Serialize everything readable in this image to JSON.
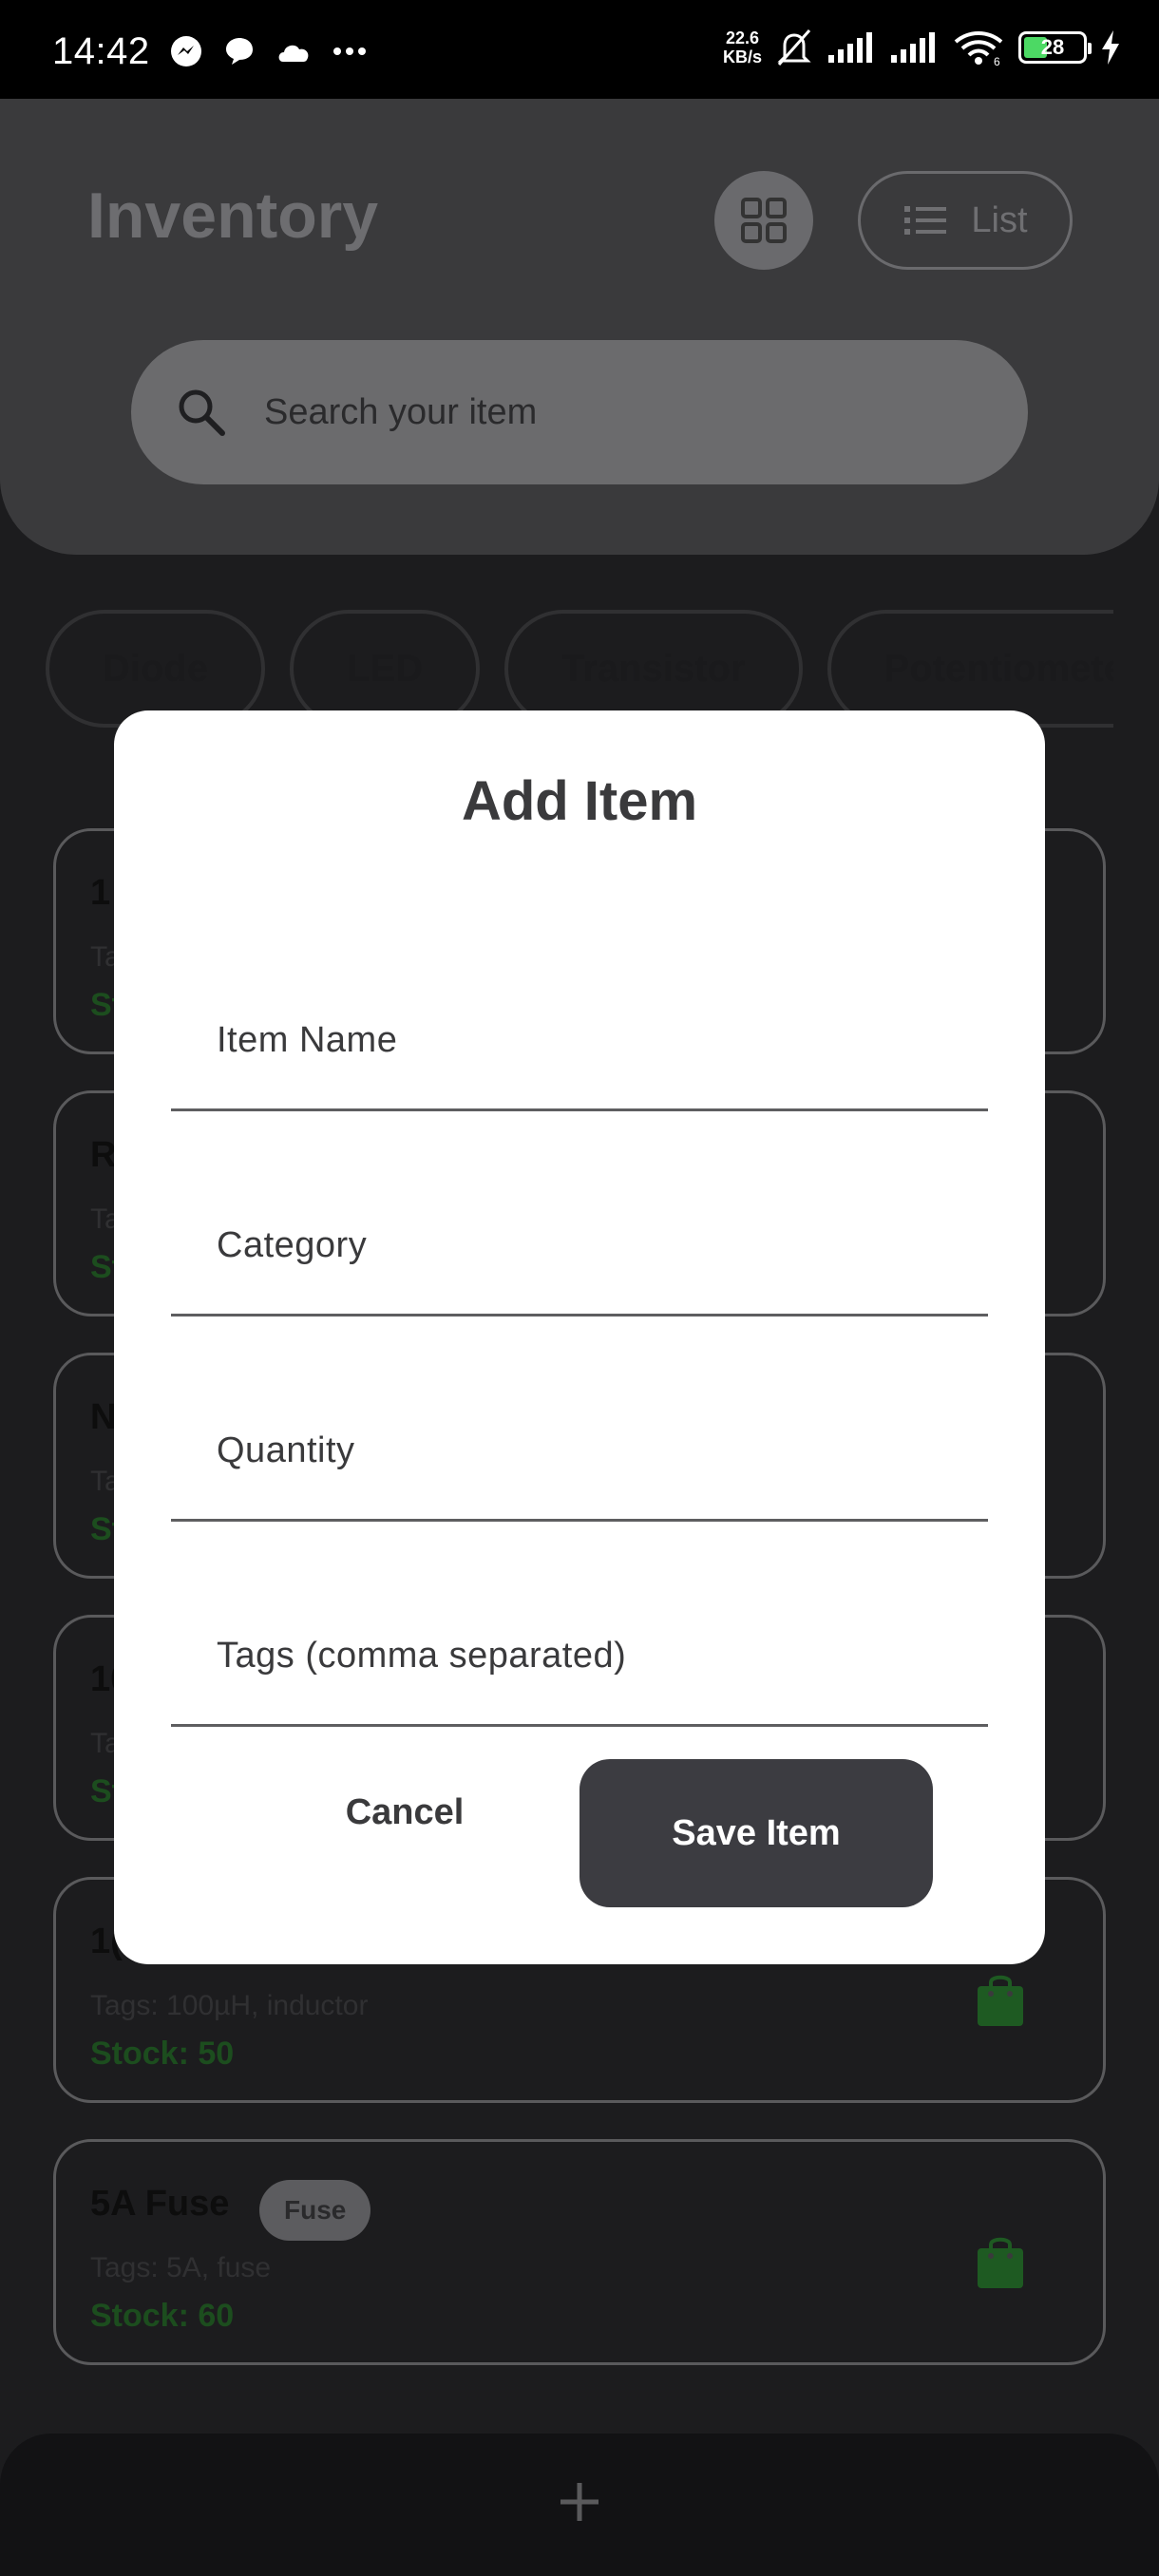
{
  "status_bar": {
    "time": "14:42",
    "net_speed_value": "22.6",
    "net_speed_unit": "KB/s",
    "wifi_badge": "6",
    "battery": "28"
  },
  "header": {
    "title": "Inventory",
    "list_label": "List",
    "search_placeholder": "Search your item"
  },
  "chips": [
    "Diode",
    "LED",
    "Transistor",
    "Potentiometer"
  ],
  "items": [
    {
      "name": "1",
      "badge": "",
      "tags": "Ta",
      "stock": "St"
    },
    {
      "name": "R",
      "badge": "",
      "tags": "Ta",
      "stock": "St"
    },
    {
      "name": "N",
      "badge": "",
      "tags": "Ta",
      "stock": "St"
    },
    {
      "name": "10",
      "badge": "",
      "tags": "Ta",
      "stock": "St"
    },
    {
      "name": "1(",
      "badge": "",
      "tags": "Tags: 100µH, inductor",
      "stock": "Stock: 50"
    },
    {
      "name": "5A Fuse",
      "badge": "Fuse",
      "tags": "Tags: 5A, fuse",
      "stock": "Stock: 60"
    }
  ],
  "dialog": {
    "title": "Add Item",
    "fields": {
      "item_name": "Item Name",
      "category": "Category",
      "quantity": "Quantity",
      "tags": "Tags (comma separated)"
    },
    "cancel": "Cancel",
    "save": "Save Item"
  },
  "colors": {
    "stock_green": "#1c4d1e",
    "bag_green": "#1e5a22",
    "save_button": "#3c3c41"
  },
  "icons": [
    "messenger-icon",
    "chat-icon",
    "cloud-icon",
    "more-icon",
    "bell-off-icon",
    "signal-icon",
    "wifi-icon",
    "battery-icon",
    "charging-icon",
    "grid-icon",
    "list-icon",
    "search-icon",
    "shopping-bag-icon",
    "plus-icon"
  ]
}
